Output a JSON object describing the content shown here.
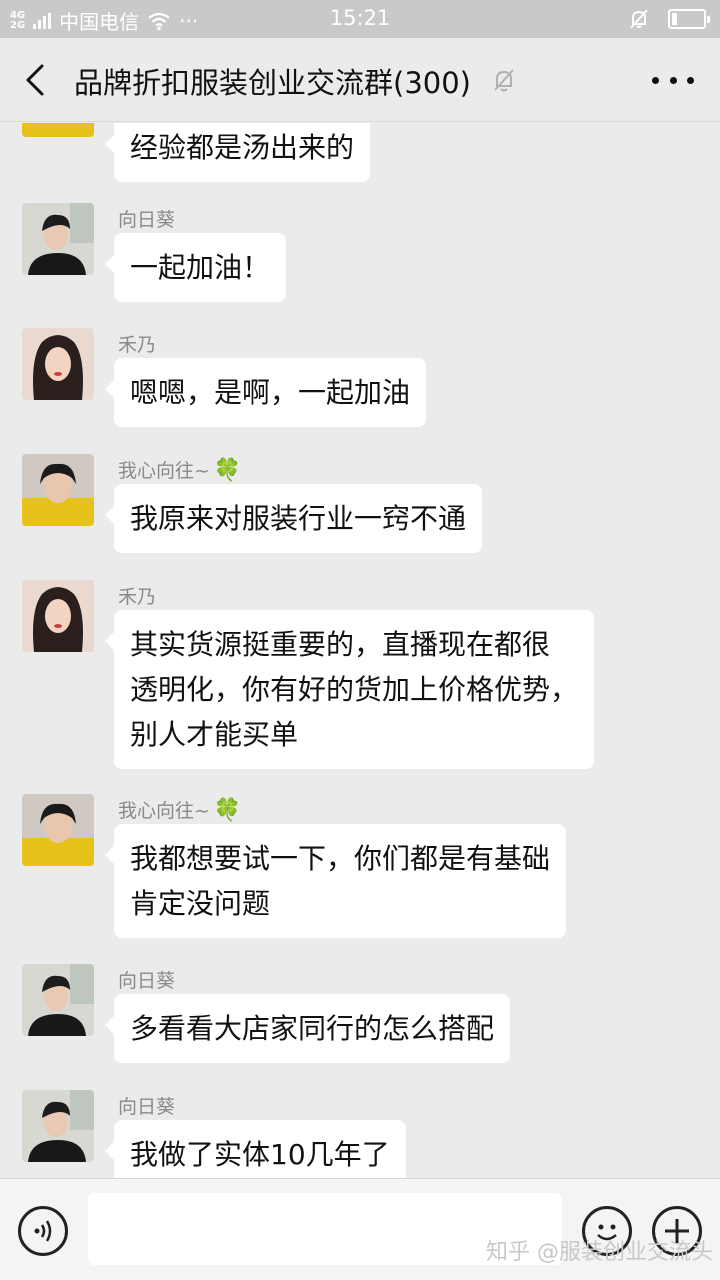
{
  "status_bar": {
    "network_top": "4G",
    "network_bottom": "2G",
    "carrier": "中国电信",
    "dots": "···",
    "time": "15:21",
    "battery_level": 0.15
  },
  "header": {
    "title": "品牌折扣服装创业交流群(300)"
  },
  "messages": [
    {
      "sender": "",
      "text": "经验都是汤出来的",
      "avatar": "yellow-shirt"
    },
    {
      "sender": "向日葵",
      "text": "一起加油！",
      "avatar": "black-top"
    },
    {
      "sender": "禾乃",
      "text": "嗯嗯，是啊，一起加油",
      "avatar": "long-hair"
    },
    {
      "sender": "我心向往~",
      "sender_emoji": "🍀",
      "text": "我原来对服装行业一窍不通",
      "avatar": "yellow-shirt"
    },
    {
      "sender": "禾乃",
      "text_lines": [
        "其实货源挺重要的，直播现在都很",
        "透明化，你有好的货加上价格优势，",
        "别人才能买单"
      ],
      "avatar": "long-hair"
    },
    {
      "sender": "我心向往~",
      "sender_emoji": "🍀",
      "text_lines": [
        "我都想要试一下，你们都是有基础",
        "肯定没问题"
      ],
      "avatar": "yellow-shirt"
    },
    {
      "sender": "向日葵",
      "text": "多看看大店家同行的怎么搭配",
      "avatar": "black-top"
    },
    {
      "sender": "向日葵",
      "text": "我做了实体10几年了",
      "avatar": "black-top"
    }
  ],
  "watermark": "知乎 @服装创业交流头",
  "colors": {
    "background": "#ebebeb",
    "bubble": "#ffffff",
    "status_bar": "#c9c9c9",
    "clover": "#3aa84b"
  }
}
